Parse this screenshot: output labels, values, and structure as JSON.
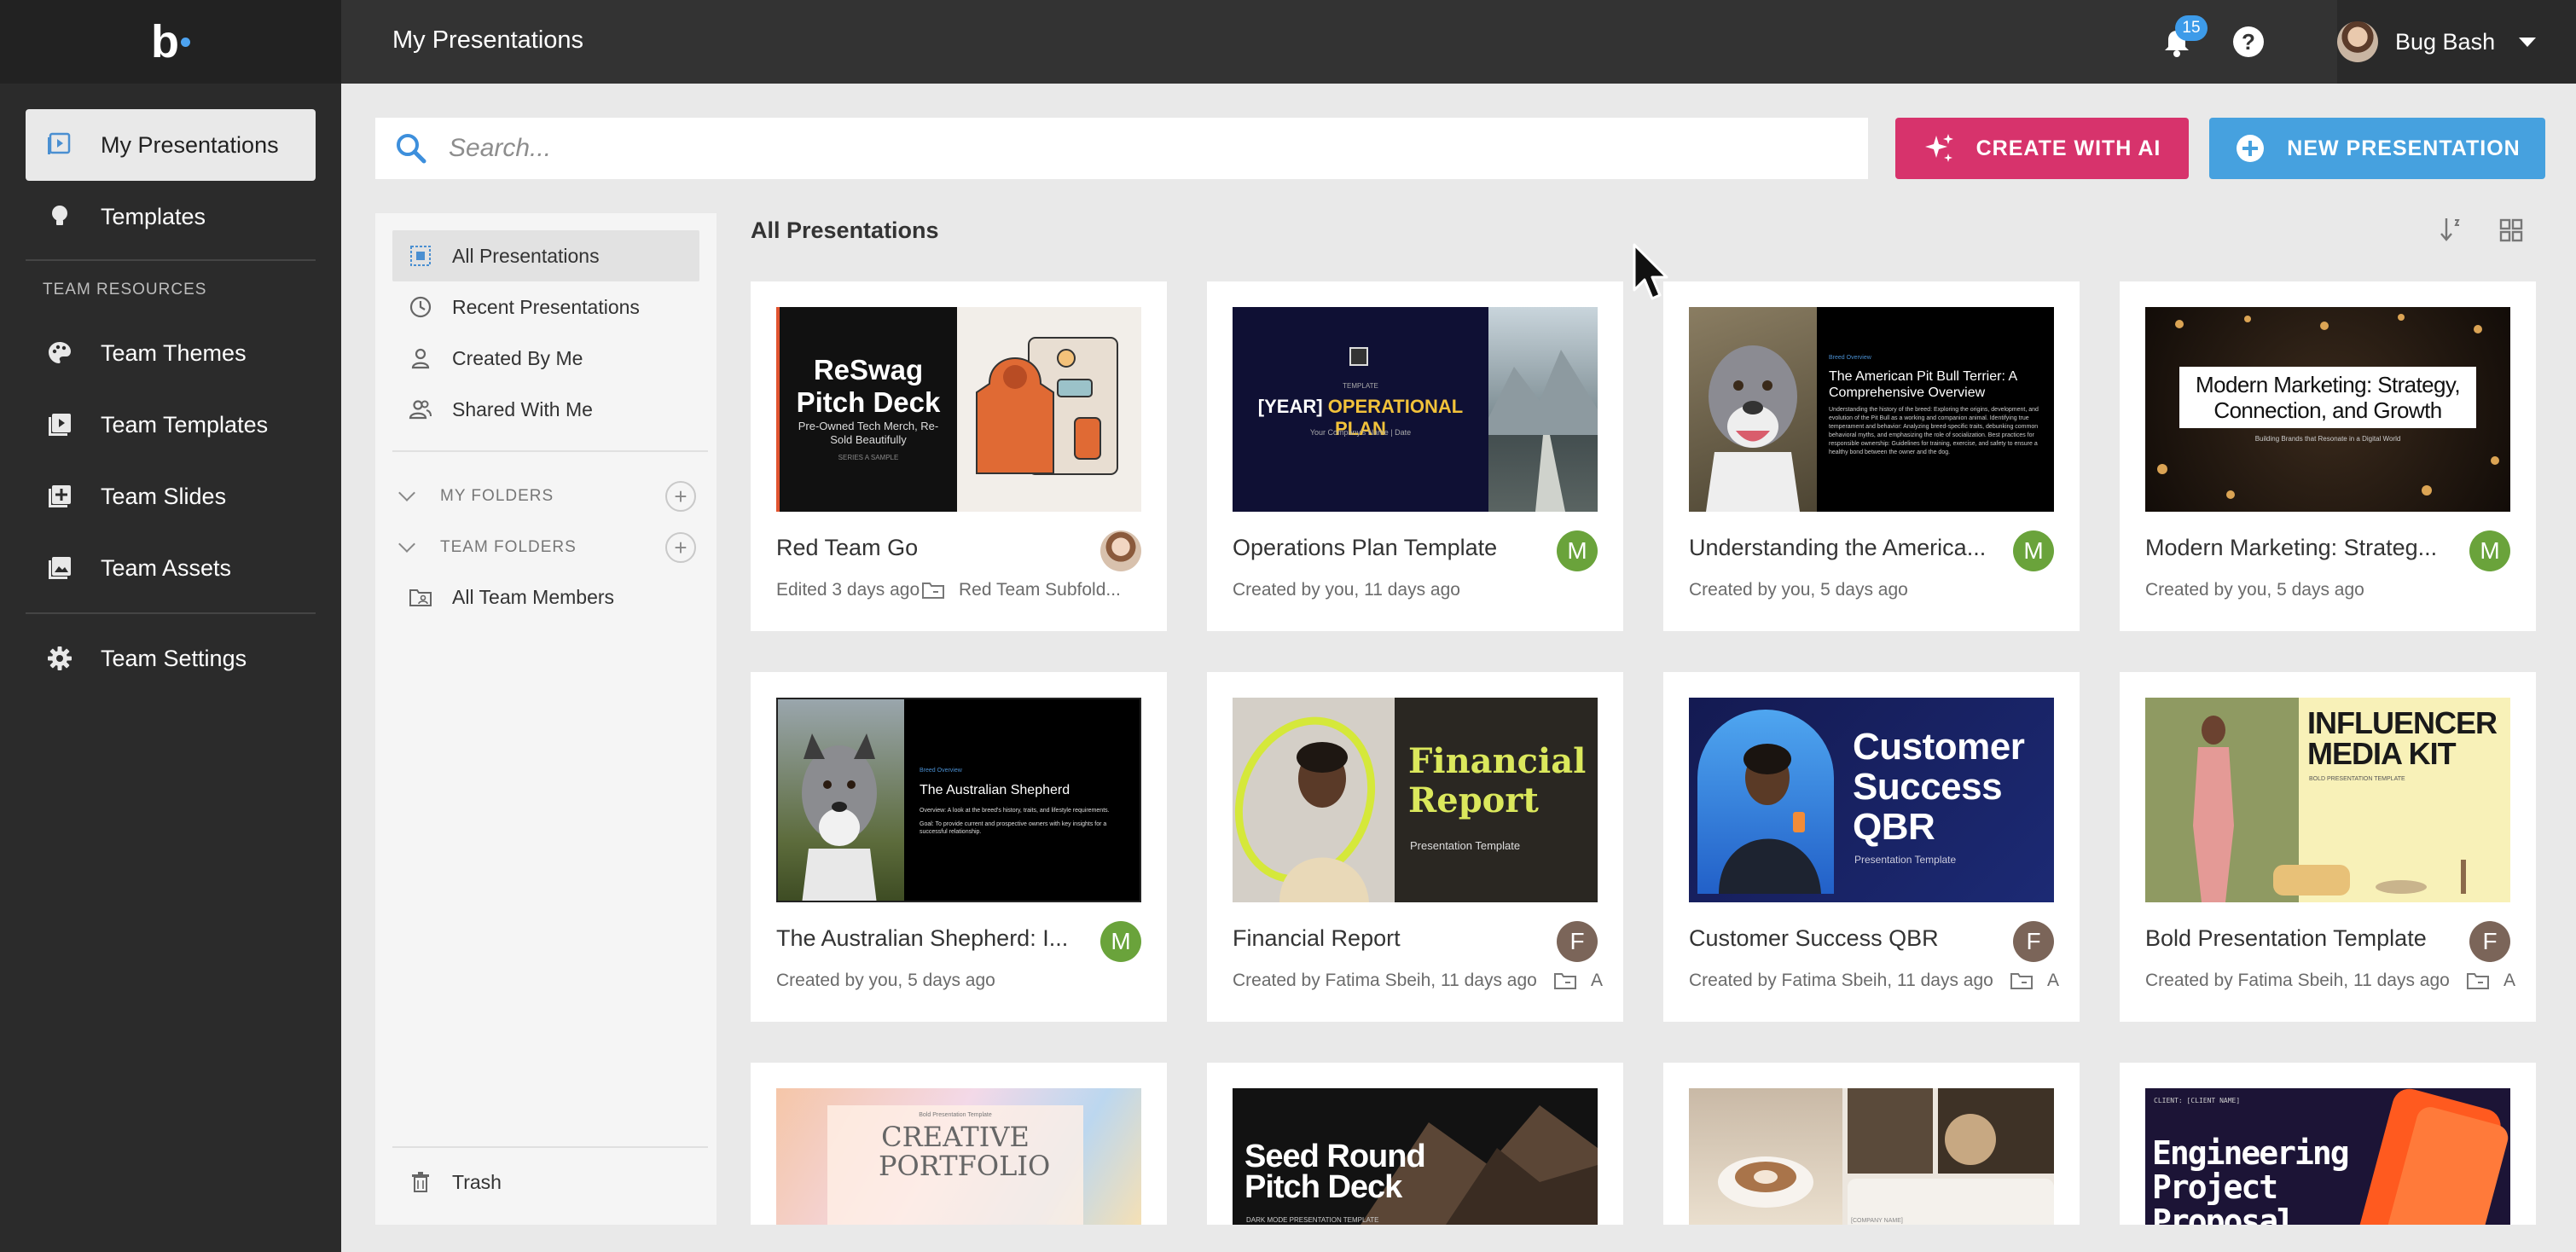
{
  "app": {
    "logo_text": "b"
  },
  "topbar": {
    "page_title": "My Presentations",
    "notification_count": "15",
    "help_symbol": "?",
    "user_name": "Bug Bash"
  },
  "sidebar": {
    "items": [
      {
        "label": "My Presentations",
        "icon": "presentation-icon"
      },
      {
        "label": "Templates",
        "icon": "lightbulb-icon"
      }
    ],
    "team_heading": "TEAM RESOURCES",
    "team_items": [
      {
        "label": "Team Themes",
        "icon": "palette-icon"
      },
      {
        "label": "Team Templates",
        "icon": "template-icon"
      },
      {
        "label": "Team Slides",
        "icon": "add-slide-icon"
      },
      {
        "label": "Team Assets",
        "icon": "image-icon"
      }
    ],
    "settings_label": "Team Settings"
  },
  "search": {
    "placeholder": "Search..."
  },
  "actions": {
    "create_ai": "CREATE WITH AI",
    "new_presentation": "NEW PRESENTATION"
  },
  "folders": {
    "filters": [
      "All Presentations",
      "Recent Presentations",
      "Created By Me",
      "Shared With Me"
    ],
    "my_folders": "MY FOLDERS",
    "team_folders": "TEAM FOLDERS",
    "team_folder_items": [
      "All Team Members"
    ],
    "trash": "Trash"
  },
  "grid": {
    "title": "All Presentations",
    "cards": [
      {
        "title": "Red Team Go",
        "meta": "Edited 3 days ago",
        "folder": "Red Team Subfold...",
        "avatar": ""
      },
      {
        "title": "Operations Plan Template",
        "meta": "Created by you, 11 days ago",
        "folder": "",
        "avatar": "M"
      },
      {
        "title": "Understanding the America...",
        "meta": "Created by you, 5 days ago",
        "folder": "",
        "avatar": "M"
      },
      {
        "title": "Modern Marketing: Strateg...",
        "meta": "Created by you, 5 days ago",
        "folder": "",
        "avatar": "M"
      },
      {
        "title": "The Australian Shepherd: I...",
        "meta": "Created by you, 5 days ago",
        "folder": "",
        "avatar": "M"
      },
      {
        "title": "Financial Report",
        "meta": "Created by Fatima Sbeih, 11 days ago",
        "folder": "A",
        "avatar": "F"
      },
      {
        "title": "Customer Success QBR",
        "meta": "Created by Fatima Sbeih, 11 days ago",
        "folder": "A",
        "avatar": "F"
      },
      {
        "title": "Bold Presentation Template",
        "meta": "Created by Fatima Sbeih, 11 days ago",
        "folder": "A",
        "avatar": "F"
      }
    ],
    "thumbs": {
      "reswag_title": "ReSwag Pitch Deck",
      "reswag_sub": "Pre-Owned Tech Merch, Re-Sold Beautifully",
      "reswag_tag": "SERIES A SAMPLE",
      "ops_tag": "TEMPLATE",
      "ops_title_a": "[YEAR]",
      "ops_title_b": "OPERATIONAL PLAN",
      "ops_sub": "Your Company's Name | Date",
      "pitbull_kicker": "Breed Overview",
      "pitbull_title": "The American Pit Bull Terrier: A Comprehensive Overview",
      "pitbull_bullets": "Understanding the history of the breed: Exploring the origins, development, and evolution of the Pit Bull as a working and companion animal. Identifying true temperament and behavior: Analyzing breed-specific traits, debunking common behavioral myths, and emphasizing the role of socialization. Best practices for responsible ownership: Guidelines for training, exercise, and safety to ensure a healthy bond between the owner and the dog.",
      "marketing_title": "Modern Marketing: Strategy, Connection, and Growth",
      "marketing_sub": "Building Brands that Resonate in a Digital World",
      "aussie_kicker": "Breed Overview",
      "aussie_title": "The Australian Shepherd",
      "aussie_b1": "Overview: A look at the breed's history, traits, and lifestyle requirements.",
      "aussie_b2": "Goal: To provide current and prospective owners with key insights for a successful relationship.",
      "fin_title": "Financial Report",
      "fin_sub": "Presentation Template",
      "qbr_title": "Customer Success QBR",
      "qbr_sub": "Presentation Template",
      "inf_title": "INFLUENCER MEDIA KIT",
      "inf_sub": "BOLD PRESENTATION TEMPLATE",
      "creative_kicker": "Bold Presentation Template",
      "creative_title": "CREATIVE PORTFOLIO",
      "seed_title": "Seed Round Pitch Deck",
      "seed_sub": "DARK MODE PRESENTATION TEMPLATE",
      "coffee_caption": "[COMPANY NAME]",
      "eng_kicker": "CLIENT: [CLIENT NAME]",
      "eng_title": "Engineering Project Proposal"
    }
  },
  "colors": {
    "accent_ai": "#d7336c",
    "accent_new": "#46a1df",
    "badge": "#3d9be9"
  }
}
